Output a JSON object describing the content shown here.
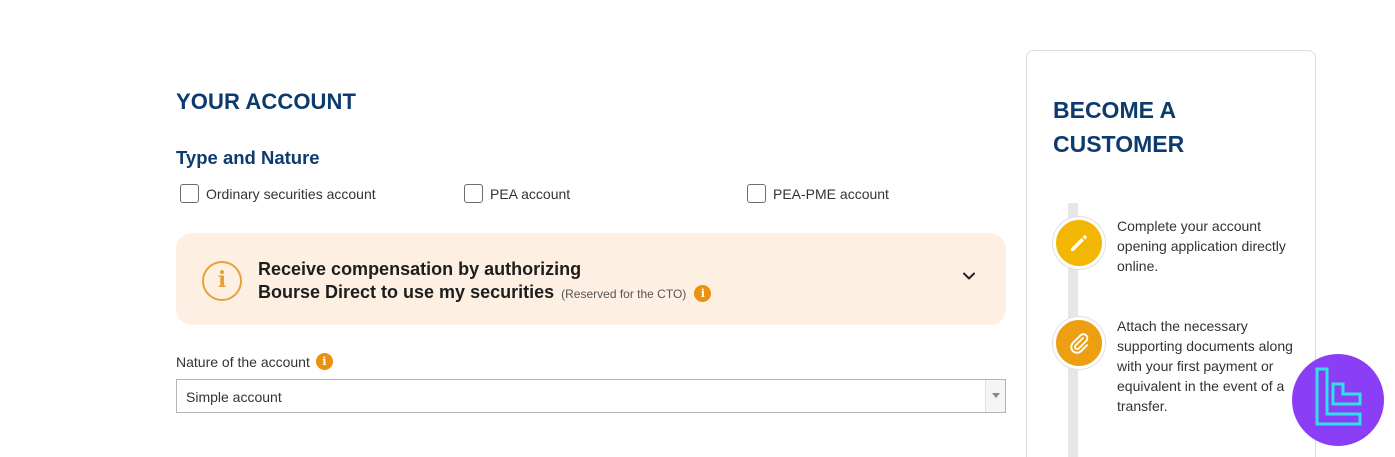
{
  "main": {
    "page_title": "YOUR ACCOUNT",
    "section_title": "Type and Nature",
    "account_types": [
      {
        "label": "Ordinary securities account",
        "checked": false
      },
      {
        "label": "PEA account",
        "checked": false
      },
      {
        "label": "PEA-PME account",
        "checked": false
      }
    ],
    "info_panel": {
      "icon": "info-icon",
      "line1": "Receive compensation by authorizing",
      "line2": "Bourse Direct to use my securities",
      "note": "(Reserved for the CTO)",
      "expand_icon": "chevron-down-icon"
    },
    "nature_field": {
      "label": "Nature of the account",
      "value": "Simple account"
    }
  },
  "sidebar": {
    "title_line1": "BECOME A",
    "title_line2": "CUSTOMER",
    "steps": [
      {
        "icon": "pencil-icon",
        "text": "Complete your account opening application directly online."
      },
      {
        "icon": "paperclip-icon",
        "text": "Attach the necessary supporting documents along with your first payment or equivalent in the event of a transfer."
      }
    ]
  },
  "colors": {
    "heading": "#0d3b6e",
    "panel_bg": "#fdf0e2",
    "accent_orange": "#e8920f",
    "step_yellow": "#f2b705",
    "badge_purple": "#8a3ef5",
    "badge_cyan": "#2fe0e6"
  }
}
